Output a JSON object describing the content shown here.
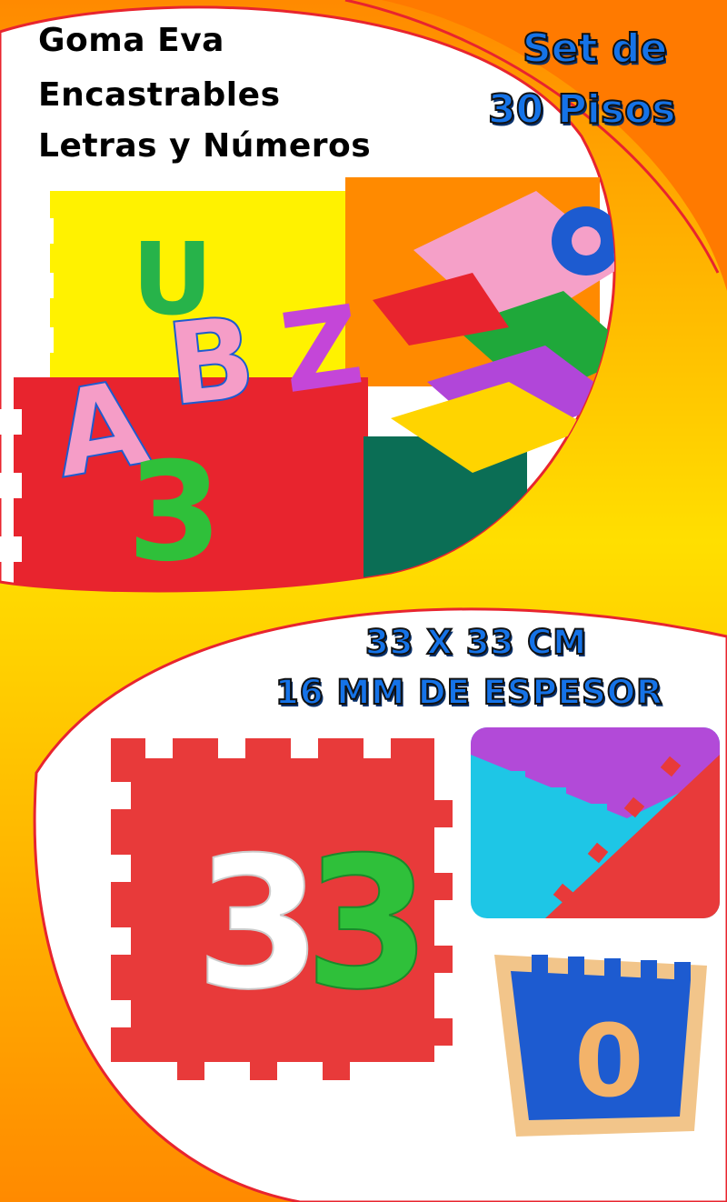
{
  "product": {
    "title_lines": [
      "Goma Eva",
      "Encastrables",
      "Letras y Números"
    ],
    "badge_lines": [
      "Set de",
      "30 Pisos"
    ]
  },
  "specs": {
    "lines": [
      "33 X 33 CM",
      "16 MM DE ESPESOR"
    ]
  },
  "top_photo": {
    "visible_characters": [
      "U",
      "A",
      "B",
      "Z",
      "3"
    ]
  },
  "big_tile": {
    "number_digits": [
      "3",
      "3"
    ]
  },
  "small_tile": {
    "number": "0"
  },
  "colors": {
    "background_orange": "#ff8a00",
    "background_yellow": "#ffd000",
    "accent_red": "#e8242e",
    "title_blue": "#1573e8",
    "tile_red": "#e83a3a",
    "tile_green": "#2fc03a",
    "tile_blue": "#1d5bd0",
    "tile_pink": "#f49ac1"
  }
}
